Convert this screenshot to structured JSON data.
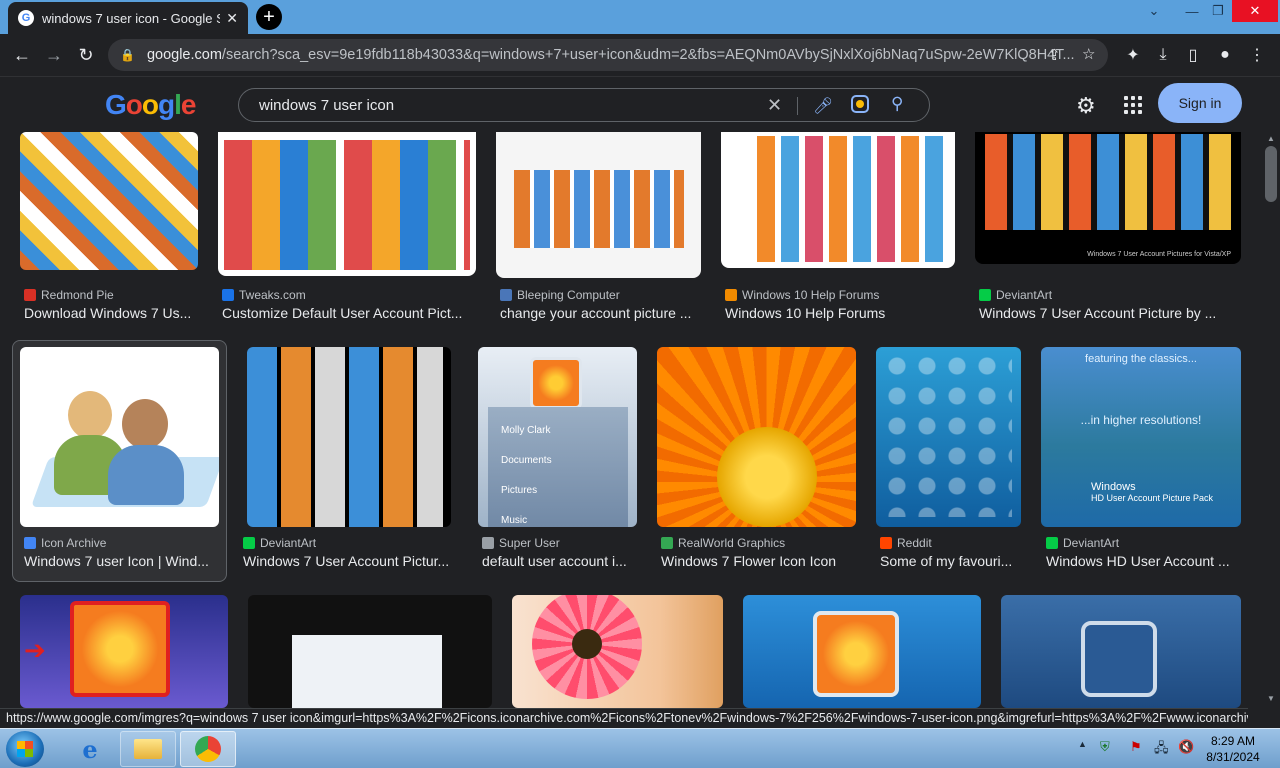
{
  "browser": {
    "tab_title": "windows 7 user icon - Google Se",
    "url_domain": "google.com",
    "url_rest": "/search?sca_esv=9e19fdb118b43033&q=windows+7+user+icon&udm=2&fbs=AEQNm0AVbySjNxlXoj6bNaq7uSpw-2eW7KlQ8H4T...",
    "tab_close": "✕",
    "new_tab": "+"
  },
  "google": {
    "logo_text": "Google",
    "search_query": "windows 7 user icon",
    "sign_in": "Sign in"
  },
  "results": [
    {
      "source": "Redmond Pie",
      "caption": "Download Windows 7 Us...",
      "fav": "#d93025"
    },
    {
      "source": "Tweaks.com",
      "caption": "Customize Default User Account Pict...",
      "fav": "#1a73e8"
    },
    {
      "source": "Bleeping Computer",
      "caption": "change your account picture ...",
      "fav": "#4a76b8"
    },
    {
      "source": "Windows 10 Help Forums",
      "caption": "Windows 10 Help Forums",
      "fav": "#f28b00"
    },
    {
      "source": "DeviantArt",
      "caption": "Windows 7 User Account Picture by ...",
      "fav": "#05cc47"
    },
    {
      "source": "Icon Archive",
      "caption": "Windows 7 user Icon | Wind...",
      "fav": "#4285f4"
    },
    {
      "source": "DeviantArt",
      "caption": "Windows 7 User Account Pictur...",
      "fav": "#05cc47"
    },
    {
      "source": "Super User",
      "caption": "default user account i...",
      "fav": "#9aa0a6"
    },
    {
      "source": "RealWorld Graphics",
      "caption": "Windows 7 Flower Icon Icon",
      "fav": "#34a853"
    },
    {
      "source": "Reddit",
      "caption": "Some of my favouri...",
      "fav": "#ff4500"
    },
    {
      "source": "DeviantArt",
      "caption": "Windows HD User Account ...",
      "fav": "#05cc47"
    }
  ],
  "thumb_text": {
    "menu_items": [
      "Molly Clark",
      "Documents",
      "Pictures",
      "Music"
    ],
    "featuring": "featuring the classics...",
    "higher": "...in higher resolutions!",
    "hd_title": "Windows",
    "hd_sub": "HD User Account Picture Pack",
    "vista": "Windows 7 User Account Pictures for Vista/XP"
  },
  "status_url": "https://www.google.com/imgres?q=windows 7 user icon&imgurl=https%3A%2F%2Ficons.iconarchive.com%2Ficons%2Ftonev%2Fwindows-7%2F256%2Fwindows-7-user-icon.png&imgrefurl=https%3A%2F%2Fwww.iconarchive.com%...",
  "taskbar": {
    "time": "8:29 AM",
    "date": "8/31/2024"
  }
}
